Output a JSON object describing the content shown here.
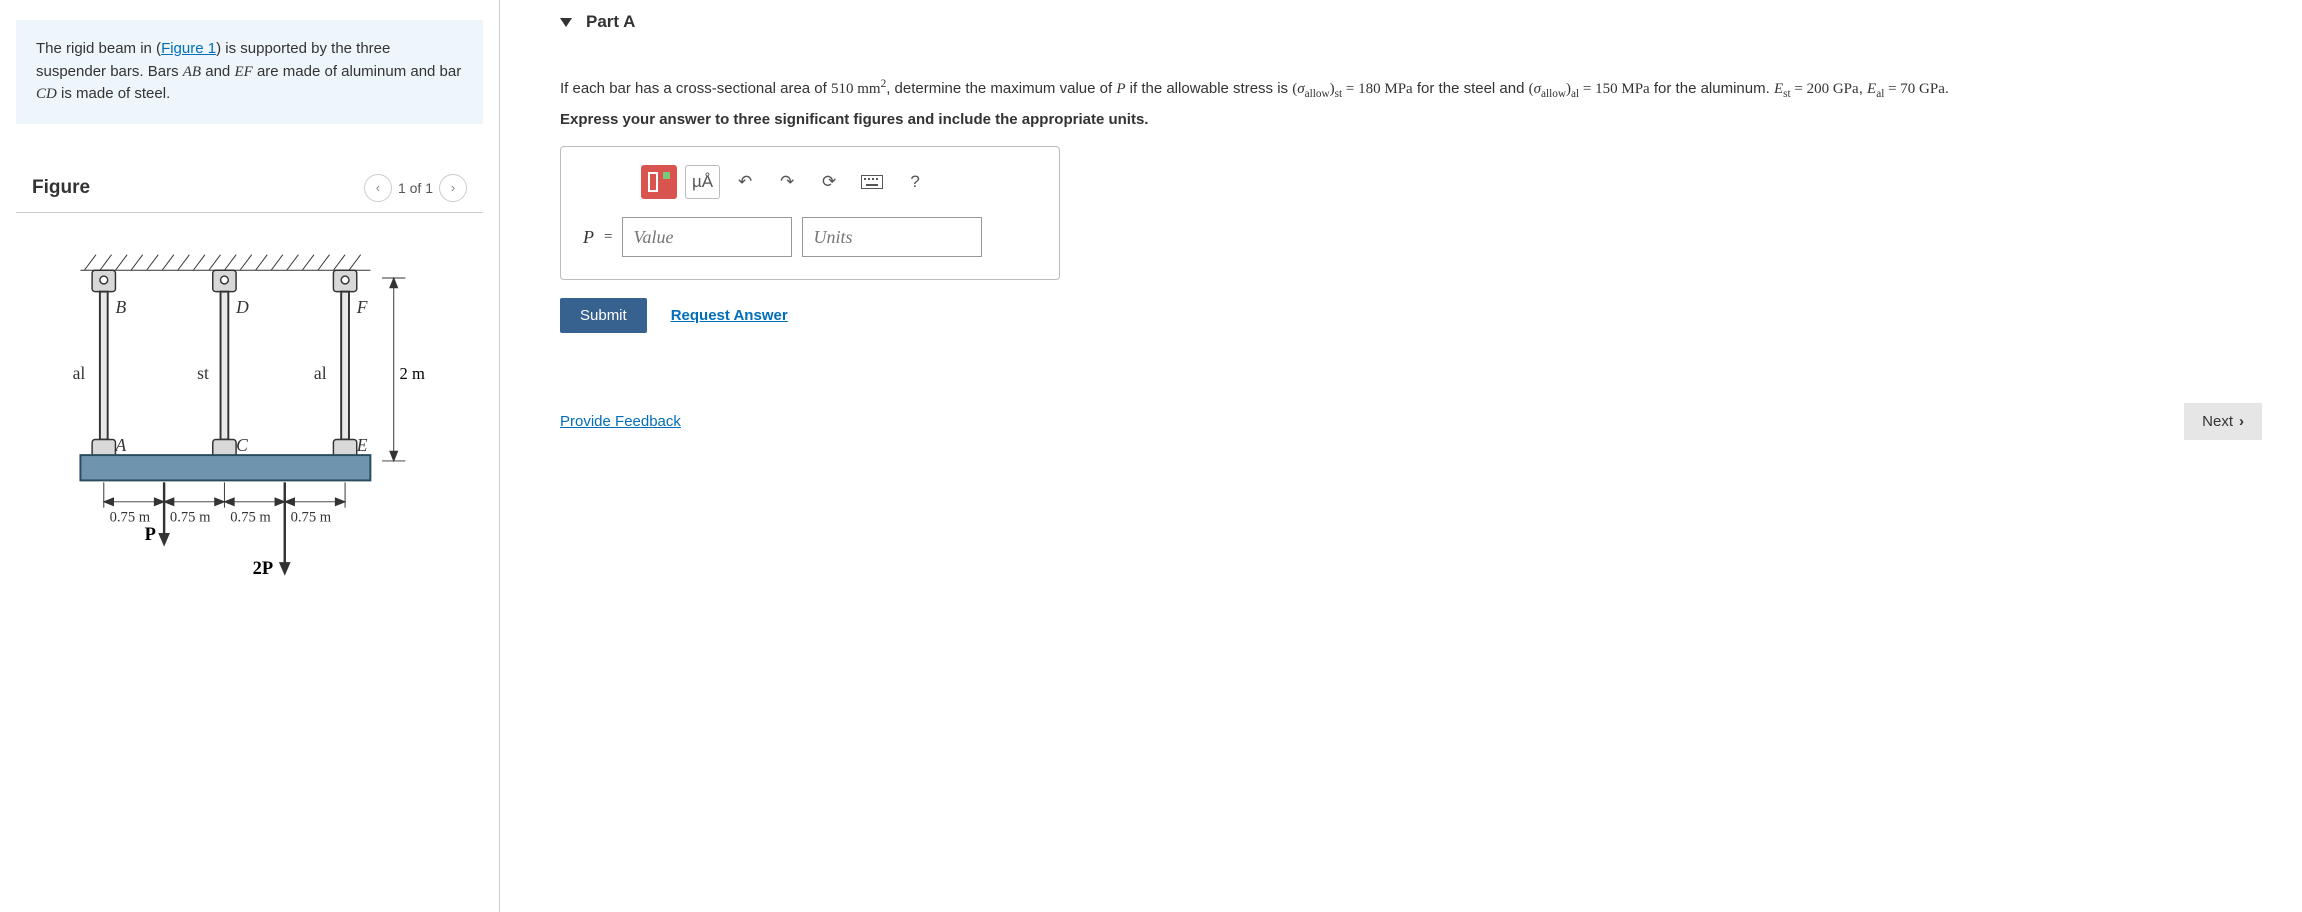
{
  "intro": {
    "prefix": "The rigid beam in (",
    "figlink": "Figure 1",
    "after_link": ") is supported by the three suspender bars. Bars ",
    "bar1": "AB",
    "mid1": " and ",
    "bar2": "EF",
    "mid2": " are made of aluminum and bar ",
    "bar3": "CD",
    "suffix": " is made of steel."
  },
  "figure": {
    "title": "Figure",
    "pager": "1 of 1",
    "labels": {
      "B": "B",
      "D": "D",
      "F": "F",
      "A": "A",
      "C": "C",
      "E": "E",
      "al": "al",
      "st": "st",
      "h": "2 m",
      "d": "0.75 m",
      "P": "P",
      "twoP": "2P"
    }
  },
  "part": {
    "title": "Part A"
  },
  "question": {
    "pre": "If each bar has a cross-sectional area of ",
    "area": "510 mm",
    "area_exp": "2",
    "mid1": ", determine the maximum value of ",
    "Pvar": "P",
    "mid2": " if the allowable stress is ",
    "sig": "σ",
    "allow_sub": "allow",
    "st_sub": "st",
    "al_sub": "al",
    "eq": " = ",
    "sig_st_val": "180 MPa",
    "mid3": " for the steel and ",
    "sig_al_val": "150 MPa",
    "mid4": " for the aluminum. ",
    "Evar": "E",
    "Est_val": "200 GPa",
    "comma": ", ",
    "Eal_val": "70 GPa",
    "period": ".",
    "paren_open": "(",
    "paren_close": ")",
    "hint": "Express your answer to three significant figures and include the appropriate units."
  },
  "toolbar": {
    "mu_label": "µÅ",
    "help": "?"
  },
  "answer": {
    "var": "P",
    "equals": " = ",
    "value_ph": "Value",
    "units_ph": "Units"
  },
  "buttons": {
    "submit": "Submit",
    "request": "Request Answer",
    "feedback": "Provide Feedback",
    "next": "Next"
  }
}
